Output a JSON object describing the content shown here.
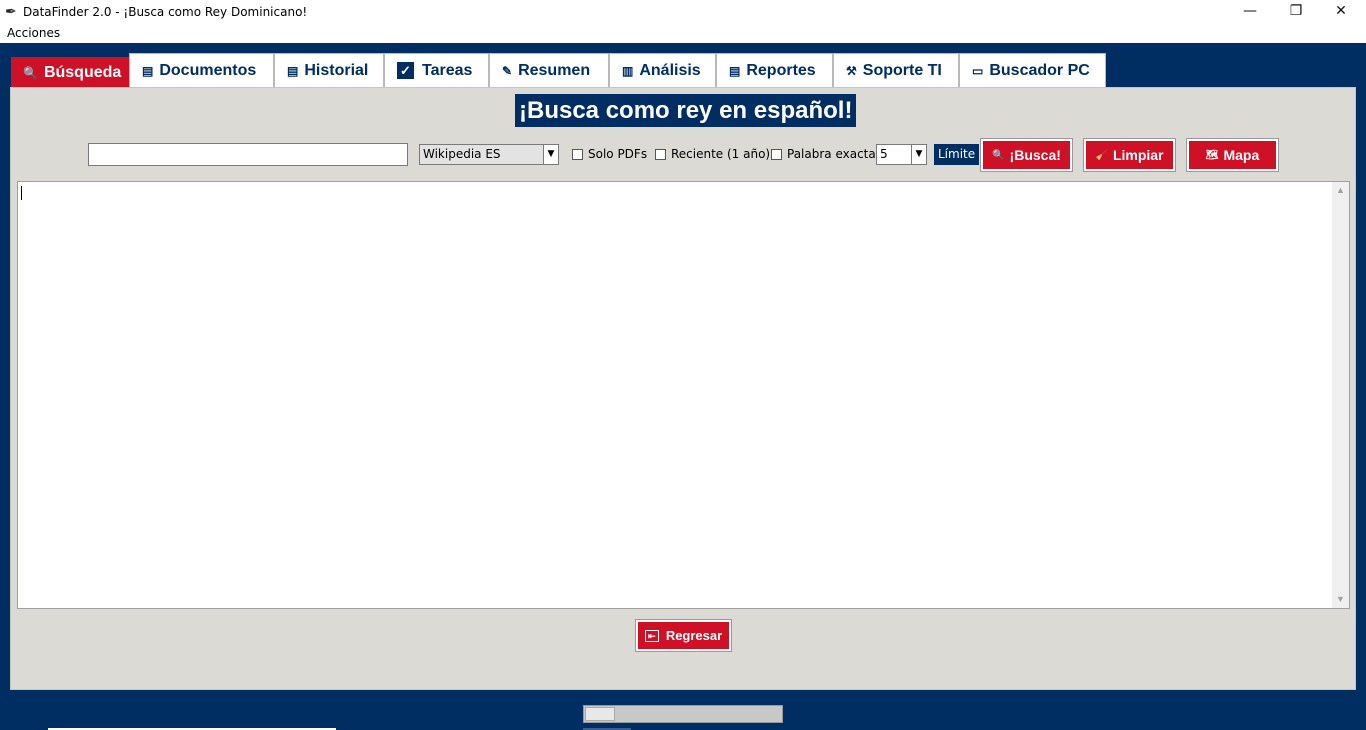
{
  "window": {
    "title": "DataFinder 2.0 - ¡Busca como Rey Dominicano!",
    "minimize": "—",
    "maximize": "❐",
    "close": "✕"
  },
  "menubar": {
    "items": [
      "Acciones"
    ]
  },
  "tabs": [
    {
      "label": "Búsqueda",
      "icon": "search-icon",
      "active": true
    },
    {
      "label": "Documentos",
      "icon": "document-icon"
    },
    {
      "label": "Historial",
      "icon": "history-icon"
    },
    {
      "label": "Tareas",
      "icon": "checkbox-icon"
    },
    {
      "label": "Resumen",
      "icon": "edit-icon"
    },
    {
      "label": "Análisis",
      "icon": "chart-icon"
    },
    {
      "label": "Reportes",
      "icon": "report-icon"
    },
    {
      "label": "Soporte TI",
      "icon": "tools-icon"
    },
    {
      "label": "Buscador PC",
      "icon": "computer-icon"
    }
  ],
  "search": {
    "banner": "¡Busca como rey en español!",
    "query_value": "",
    "source_selected": "Wikipedia ES",
    "options": {
      "solo_pdfs": "Solo PDFs",
      "reciente": "Reciente (1 año)",
      "palabra_exacta": "Palabra exacta"
    },
    "limit_value": "5",
    "limit_label": "Límite",
    "busca_button": "¡Busca!",
    "limpiar_button": "Limpiar",
    "mapa_button": "Mapa",
    "results_text": ""
  },
  "footer": {
    "regresar_button": "Regresar"
  },
  "colors": {
    "navy": "#002d62",
    "red": "#ce1126",
    "panel": "#dcdad5"
  }
}
